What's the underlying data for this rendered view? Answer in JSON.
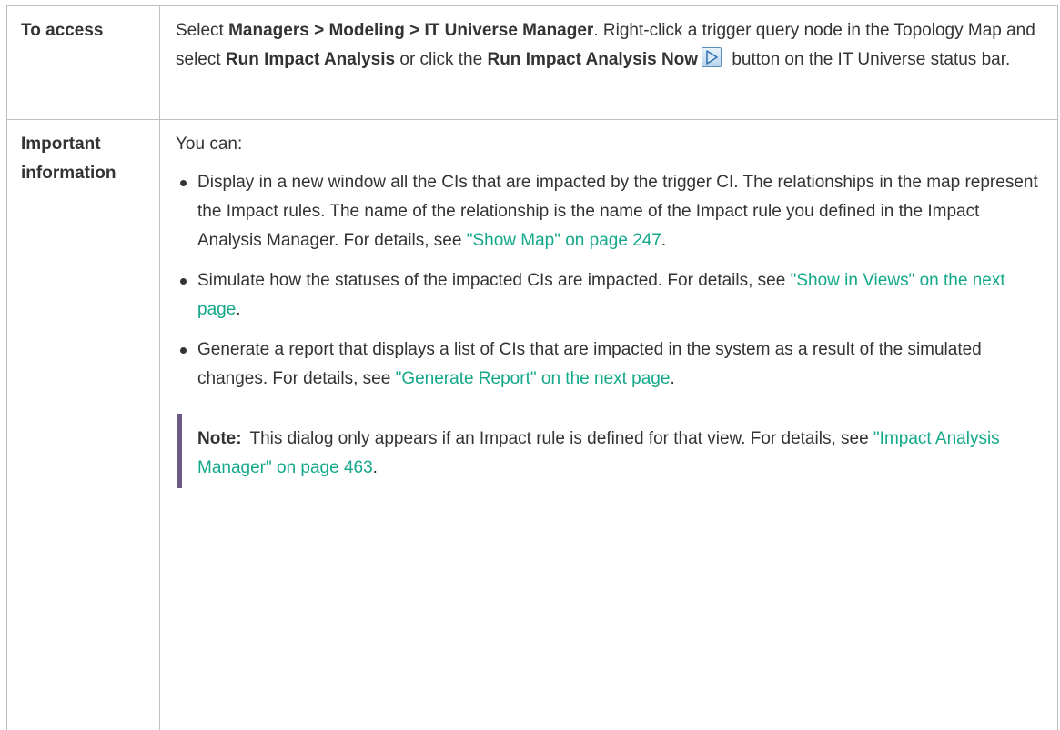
{
  "table": {
    "row_access": {
      "label": "To access",
      "t1": "Select ",
      "b1": "Managers > Modeling > IT Universe Manager",
      "t2": ". Right-click a trigger query node in the Topology Map and select ",
      "b2": "Run Impact Analysis",
      "t3": " or click the ",
      "b3": "Run Impact Analysis Now",
      "icon": "play-arrow-icon",
      "t4": " button on the IT Universe status bar."
    },
    "row_important": {
      "label": "Important information",
      "intro": "You can:",
      "bullets": [
        {
          "text": "Display in a new window all the CIs that are impacted by the trigger CI. The relationships in the map represent the Impact rules. The name of the relationship is the name of the Impact rule you defined in the Impact Analysis Manager. For details, see ",
          "link": "\"Show Map\" on page 247",
          "end": "."
        },
        {
          "text": "Simulate how the statuses of the impacted CIs are impacted. For details, see ",
          "link": "\"Show in Views\" on the next page",
          "end": "."
        },
        {
          "text": "Generate a report that displays a list of CIs that are impacted in the system as a result of the simulated changes. For details, see ",
          "link": "\"Generate Report\" on the next page",
          "end": "."
        }
      ],
      "note": {
        "label": "Note:",
        "text": "This dialog only appears if an Impact rule is defined for that view. For details, see ",
        "link": "\"Impact Analysis Manager\" on page 463",
        "end": "."
      }
    }
  },
  "colors": {
    "link": "#14a88a",
    "note_bar": "#6a5a85",
    "border": "#bfbfbf",
    "text": "#333333"
  }
}
